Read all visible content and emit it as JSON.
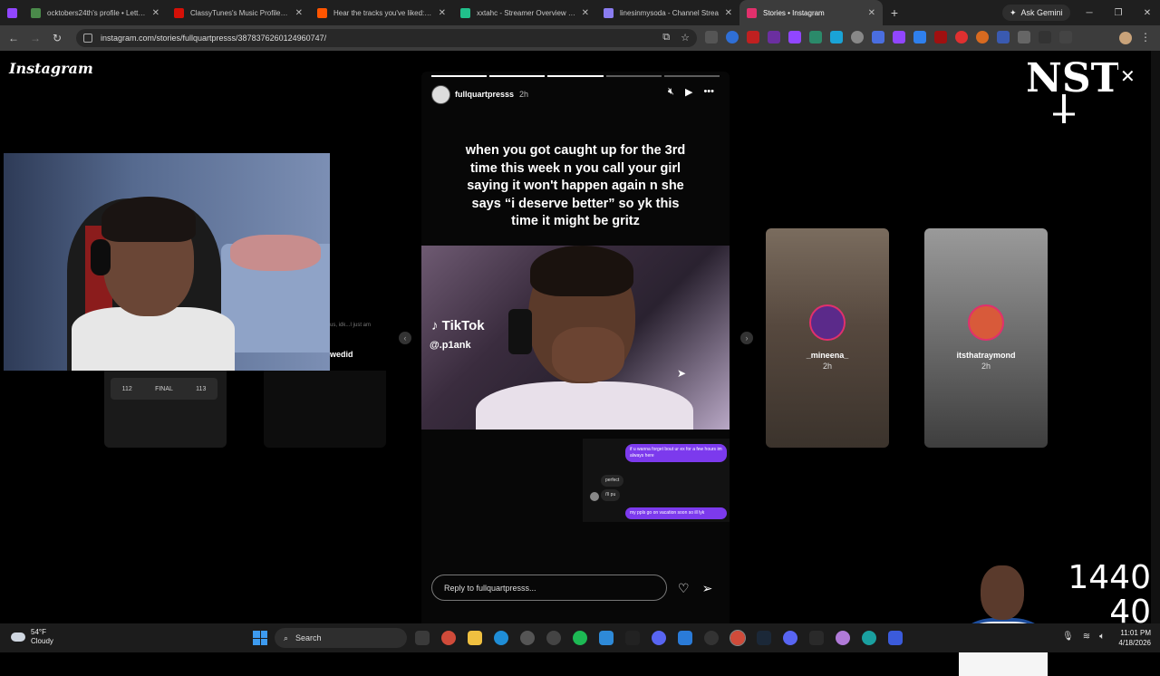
{
  "tabs": [
    {
      "title": "ocktobers24th's profile • Letterb",
      "color": "#4a8a4a",
      "glyph": "L"
    },
    {
      "title": "ClassyTunes's Music Profile | La",
      "color": "#d51007",
      "glyph": "as"
    },
    {
      "title": "Hear the tracks you've liked: on",
      "color": "#ff5500",
      "glyph": "S"
    },
    {
      "title": "xxtahc - Streamer Overview & S",
      "color": "#21c08b",
      "glyph": "T"
    },
    {
      "title": "linesinmysoda - Channel Strea",
      "color": "#8a7cf0",
      "glyph": "S"
    },
    {
      "title": "Stories • Instagram",
      "color": "#e1306c",
      "glyph": "◎"
    }
  ],
  "browser": {
    "ask_gemini": "Ask Gemini",
    "url": "instagram.com/stories/fullquartpresss/3878376260124960747/"
  },
  "instagram": {
    "logo": "Instagram",
    "story": {
      "username": "fullquartpresss",
      "time": "2h",
      "caption": "when you got caught up for the 3rd time this week n you call your girl saying it won't happen again n she says “i deserve better” so yk this time it might be gritz",
      "tiktok_label": "TikTok",
      "tiktok_handle": "@.p1ank",
      "dm_messages": [
        {
          "text": "if u wanna forget bout ur ex for a few hours im always here",
          "dir": "out"
        },
        {
          "text": "perfect",
          "dir": "in"
        },
        {
          "text": "i'll pu",
          "dir": "in"
        },
        {
          "text": "my ppls go on vacation soon so ill lyk",
          "dir": "out"
        }
      ],
      "reply_placeholder": "Reply to fullquartpresss..."
    },
    "previews": [
      {
        "name": "_mineena_",
        "time": "2h"
      },
      {
        "name": "itsthatraymond",
        "time": "2h"
      }
    ],
    "left_partial_name": "wedid",
    "left_partial_text": "us, idk...I just am",
    "scoreboard": {
      "left": "112",
      "label": "FINAL",
      "right": "113"
    }
  },
  "overlay": {
    "score_top": "1440",
    "score_bottom": "40"
  },
  "taskbar": {
    "temp": "54°F",
    "condition": "Cloudy",
    "search": "Search",
    "time": "11:01 PM",
    "date": "4/18/2026"
  }
}
